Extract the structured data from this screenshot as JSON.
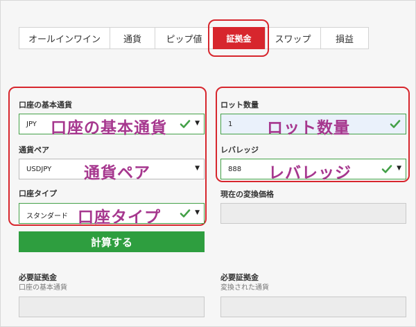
{
  "tabs": [
    {
      "label": "オールインワイン"
    },
    {
      "label": "通貨"
    },
    {
      "label": "ピップ値"
    },
    {
      "label": "証拠金"
    },
    {
      "label": "スワップ"
    },
    {
      "label": "損益"
    }
  ],
  "left": {
    "base_currency_label": "口座の基本通貨",
    "base_currency_value": "JPY",
    "base_currency_callout": "口座の基本通貨",
    "pair_label": "通貨ペア",
    "pair_value": "USDJPY",
    "pair_callout": "通貨ペア",
    "account_type_label": "口座タイプ",
    "account_type_value": "スタンダード",
    "account_type_callout": "口座タイプ"
  },
  "right": {
    "lot_label": "ロット数量",
    "lot_value": "1",
    "lot_callout": "ロット数量",
    "leverage_label": "レバレッジ",
    "leverage_value": "888",
    "leverage_callout": "レバレッジ",
    "rate_label": "現在の変換価格"
  },
  "calculate_label": "計算する",
  "results": {
    "left_label": "必要証拠金",
    "left_sub": "口座の基本通貨",
    "right_label": "必要証拠金",
    "right_sub": "変換された通貨"
  },
  "colors": {
    "accent": "#d7262d",
    "button": "#2e9e3f",
    "callout": "#a6378e",
    "valid": "#43a047"
  },
  "icons": {
    "check": "check-icon",
    "caret": "caret-down-icon"
  }
}
